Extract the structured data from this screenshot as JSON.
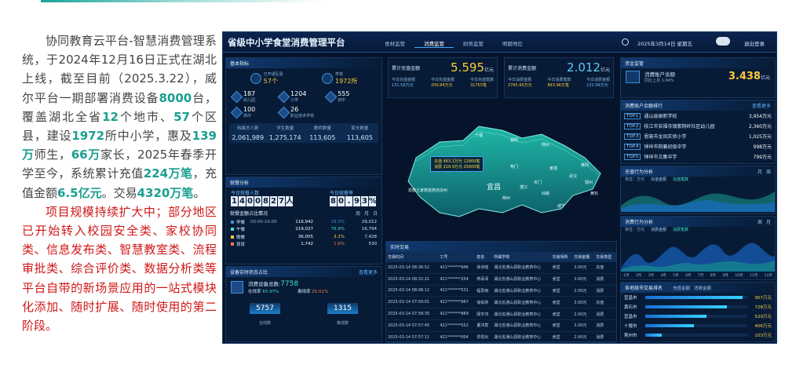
{
  "article": {
    "para1_parts": [
      {
        "t": "协同教育云平台-智慧消费管理系统，于2024年12月16日正式在湖北上线，截至目前（2025.3.22），威尔平台一期部署消费设备",
        "b": false
      },
      {
        "t": "8000",
        "b": true
      },
      {
        "t": "台，覆盖湖北全省",
        "b": false
      },
      {
        "t": "12",
        "b": true
      },
      {
        "t": "个地市、",
        "b": false
      },
      {
        "t": "57",
        "b": true
      },
      {
        "t": "个区县，建设",
        "b": false
      },
      {
        "t": "1972",
        "b": true
      },
      {
        "t": "所中小学，惠及",
        "b": false
      },
      {
        "t": "139万",
        "b": true
      },
      {
        "t": "师生，",
        "b": false
      },
      {
        "t": "66万",
        "b": true
      },
      {
        "t": "家长，2025年春季开学至今，系统累计充值",
        "b": false
      },
      {
        "t": "224万笔",
        "b": true
      },
      {
        "t": "，充值金额",
        "b": false
      },
      {
        "t": "6.5亿元",
        "b": true
      },
      {
        "t": "。交易",
        "b": false
      },
      {
        "t": "4320万笔",
        "b": true
      },
      {
        "t": "。",
        "b": false
      }
    ],
    "para2": "项目规模持续扩大中；部分地区已开始转入校园安全类、家校协同类、信息发布类、智慧教室类、流程审批类、综合评价类、数据分析类等平台自带的新场景应用的一站式模块化添加、随时扩展、随时使用的第二阶段。"
  },
  "dashboard": {
    "title": "省级中小学食堂消费管理平台",
    "nav": [
      "食材监管",
      "消费监管",
      "财务监管",
      "明厨亮灶"
    ],
    "nav_active": 1,
    "date": "2025年3月14日  星期五",
    "logout": "退出登录",
    "basic": {
      "title": "基本指标",
      "region_label": "已开通区县",
      "region_value": "57个",
      "school_label": "学校",
      "school_value": "1972所",
      "types": [
        {
          "v": "187",
          "l": "幼儿园"
        },
        {
          "v": "1204",
          "l": "小学"
        },
        {
          "v": "555",
          "l": "初中"
        },
        {
          "v": "100",
          "l": "高中"
        },
        {
          "v": "26",
          "l": "职业技术学校"
        }
      ],
      "people_headers": [
        "档案总人数",
        "学生数量",
        "教师数量",
        "家长数量"
      ],
      "people_values": [
        "2,061,989",
        "1,275,174",
        "113,605",
        "113,605"
      ]
    },
    "dining": {
      "title": "就餐分析",
      "today_people_label": "今日就餐人数",
      "today_people_digits": [
        "1",
        "4",
        "0",
        "0",
        "8",
        "2",
        "7",
        "人"
      ],
      "today_rate_label": "今日就餐率",
      "today_rate_digits": [
        "8",
        "0",
        ".",
        "9",
        "3",
        "%"
      ]
    },
    "meal_ratio": {
      "title": "就餐金额占比情况",
      "tabs": [
        "周",
        "月",
        "日"
      ],
      "rows": [
        {
          "n": "早餐",
          "t": "00:00-10:00",
          "v": "116,942",
          "p": "18.5%",
          "c": "29,012"
        },
        {
          "n": "午餐",
          "t": "",
          "v": "219,027",
          "p": "76.9%",
          "c": "16,794"
        },
        {
          "n": "晚餐",
          "t": "",
          "v": "36,005",
          "p": "3.2%",
          "c": "7,428"
        },
        {
          "n": "夜宵",
          "t": "",
          "v": "1,742",
          "p": "1.6%",
          "c": "530"
        }
      ]
    },
    "device": {
      "title": "设备实时状态占比",
      "more": "查看更多",
      "total_label": "消费设备总数:",
      "total": "7758",
      "online_label": "在线率",
      "online_rate": "65.97%",
      "offline_label": "离线率",
      "offline_rate": "25.01%",
      "online_count": "5757",
      "online_text": "在线数",
      "offline_count": "1315",
      "offline_text": "离线数"
    },
    "recharge": {
      "label": "累计充值金额",
      "value": "5.595",
      "unit": "亿元",
      "sub1_label": "今日充值金额",
      "sub1": "131.56万元",
      "sub2_label": "今日充值金额",
      "sub2": "200.84万元",
      "sub3_label": "今日充值笔数",
      "sub3": "31755笔"
    },
    "consume": {
      "label": "累计消费金额",
      "value": "2.012",
      "unit": "亿元",
      "sub1_label": "今日消费金额",
      "sub1": "2765.60万元",
      "sub2_label": "今日消费笔数",
      "sub2": "893.96万笔",
      "sub3_label": "今日消费金额",
      "sub3": "131.56万元"
    },
    "map": {
      "regions": [
        "十堰",
        "襄阳",
        "随州",
        "神农架林区",
        "荆门",
        "孝感",
        "宜昌",
        "恩施土家族苗族自治州",
        "荆州",
        "仙桃",
        "武汉",
        "鄂州",
        "黄冈",
        "咸宁",
        "黄石",
        "天门",
        "潜江"
      ],
      "popup_lines": [
        "充值  463.1万元  12800笔",
        "消费  218.9万元  25600笔"
      ]
    },
    "balance": {
      "title": "资金监管",
      "label": "消费账户余额",
      "sub": "同比上月 1.04%",
      "value": "3.438",
      "unit": "亿元"
    },
    "rank": {
      "title": "消费账户余额排行",
      "more": "查看更多",
      "items": [
        {
          "r": "TOP.1",
          "n": "通山县振新学校",
          "v": "3,954万元"
        },
        {
          "r": "TOP.2",
          "n": "枝江市安福寺镇紫荆岭社区幼儿园",
          "v": "2,360万元"
        },
        {
          "r": "TOP.3",
          "n": "恩施市龙凤实验小学",
          "v": "1,025万元"
        },
        {
          "r": "TOP.4",
          "n": "钟祥市荆襄初级中学",
          "v": "998万元"
        },
        {
          "r": "TOP.5",
          "n": "钟祥市文集中学",
          "v": "799万元"
        }
      ]
    },
    "recharge_trend": {
      "title": "充值行为分析",
      "more": "查看详情",
      "tabs": [
        "月",
        "周"
      ],
      "unit": "单位：万元",
      "legend": [
        "充值金额",
        "充值笔数"
      ]
    },
    "consume_trend": {
      "title": "消费行为分析",
      "more": "查看详情",
      "tabs": [
        "周",
        "月"
      ],
      "unit": "单位：万元",
      "legend": [
        "消费金额",
        "消费笔数"
      ],
      "months": [
        "1月",
        "2月",
        "3月",
        "4月",
        "5月",
        "6月",
        "7月",
        "8月",
        "9月",
        "10月",
        "11月",
        "12月"
      ]
    },
    "city_trans": {
      "title": "各地级市交易排名",
      "tabs": [
        "充值金额",
        "消费金额"
      ],
      "rows": [
        {
          "n": "宜昌市",
          "v": "907万元",
          "f": 0.95
        },
        {
          "n": "黄石市",
          "v": "728万元",
          "f": 0.8
        },
        {
          "n": "宜昌市",
          "v": "529万元",
          "f": 0.6
        },
        {
          "n": "十堰市",
          "v": "406万元",
          "f": 0.48
        },
        {
          "n": "荆州市",
          "v": "103万元",
          "f": 0.16
        }
      ]
    },
    "transactions": {
      "title": "实时交易",
      "headers": [
        "交易时间",
        "工号",
        "姓名",
        "所属学校",
        "交易场所",
        "交易金额",
        "交易类型"
      ],
      "rows": [
        [
          "2025-03-14 08:36:52",
          "421*******946",
          "徐诗瑶",
          "湖北省通山县职业教育中心",
          "食堂",
          "3.00元",
          "充值"
        ],
        [
          "2025-03-14 08:32:21",
          "421*******254",
          "蒋承泽",
          "湖北省通山县职业教育中心",
          "食堂",
          "3.00元",
          "消费"
        ],
        [
          "2025-03-14 08:06:12",
          "421*******531",
          "程思雨",
          "湖北省通山县职业教育中心",
          "食堂",
          "2.00元",
          "消费"
        ],
        [
          "2025-03-14 07:59:01",
          "421*******967",
          "徐佑林",
          "湖北省通山县职业教育中心",
          "食堂",
          "3.00元",
          "充值"
        ],
        [
          "2025-03-14 07:58:35",
          "421*******889",
          "顾宇鸿",
          "湖北省通山县职业教育中心",
          "食堂",
          "2.00元",
          "消费"
        ],
        [
          "2025-03-14 07:57:45",
          "421*******552",
          "董沐宸",
          "湖北省通山县职业教育中心",
          "食堂",
          "3.00元",
          "消费"
        ],
        [
          "2025-03-14 07:57:11",
          "421*******004",
          "贾悦出",
          "湖北省通山县职业教育中心",
          "食堂",
          "2.00元",
          "消费"
        ]
      ]
    }
  }
}
